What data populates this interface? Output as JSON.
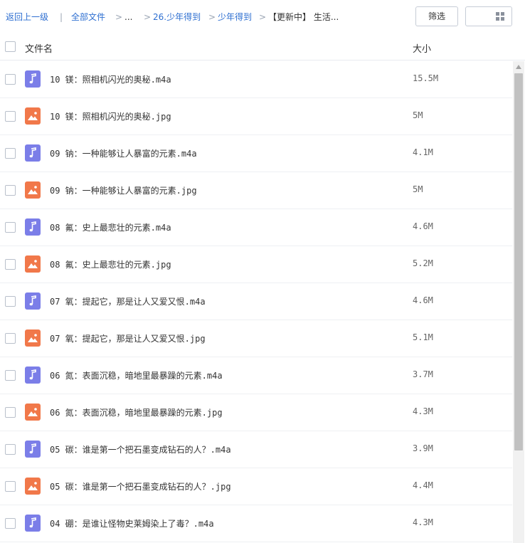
{
  "toolbar": {
    "back_label": "返回上一级",
    "separator": "|",
    "all_files_label": "全部文件",
    "ellipsis": "...",
    "crumb_1": "26.少年得到",
    "crumb_2": "少年得到",
    "crumb_current": "【更新中】 生活...",
    "chevron": ">",
    "filter_label": "筛选"
  },
  "header": {
    "name_col": "文件名",
    "size_col": "大小"
  },
  "files": [
    {
      "name": "10 镁：照相机闪光的奥秘.m4a",
      "size": "15.5M",
      "type": "audio",
      "icon": "music-note-icon"
    },
    {
      "name": "10 镁：照相机闪光的奥秘.jpg",
      "size": "5M",
      "type": "image",
      "icon": "image-icon"
    },
    {
      "name": "09 钠：一种能够让人暴富的元素.m4a",
      "size": "4.1M",
      "type": "audio",
      "icon": "music-note-icon"
    },
    {
      "name": "09 钠：一种能够让人暴富的元素.jpg",
      "size": "5M",
      "type": "image",
      "icon": "image-icon"
    },
    {
      "name": "08 氟：史上最悲壮的元素.m4a",
      "size": "4.6M",
      "type": "audio",
      "icon": "music-note-icon"
    },
    {
      "name": "08 氟：史上最悲壮的元素.jpg",
      "size": "5.2M",
      "type": "image",
      "icon": "image-icon"
    },
    {
      "name": "07 氧：提起它，那是让人又爱又恨.m4a",
      "size": "4.6M",
      "type": "audio",
      "icon": "music-note-icon"
    },
    {
      "name": "07 氧：提起它，那是让人又爱又恨.jpg",
      "size": "5.1M",
      "type": "image",
      "icon": "image-icon"
    },
    {
      "name": "06 氮：表面沉稳，暗地里最暴躁的元素.m4a",
      "size": "3.7M",
      "type": "audio",
      "icon": "music-note-icon"
    },
    {
      "name": "06 氮：表面沉稳，暗地里最暴躁的元素.jpg",
      "size": "4.3M",
      "type": "image",
      "icon": "image-icon"
    },
    {
      "name": "05 碳：谁是第一个把石墨变成钻石的人？.m4a",
      "size": "3.9M",
      "type": "audio",
      "icon": "music-note-icon"
    },
    {
      "name": "05 碳：谁是第一个把石墨变成钻石的人？.jpg",
      "size": "4.4M",
      "type": "image",
      "icon": "image-icon"
    },
    {
      "name": "04 硼：是谁让怪物史莱姆染上了毒？.m4a",
      "size": "4.3M",
      "type": "audio",
      "icon": "music-note-icon"
    }
  ],
  "colors": {
    "link": "#2e6fd1",
    "audio_icon": "#7b7ee8",
    "image_icon": "#f1784a"
  }
}
